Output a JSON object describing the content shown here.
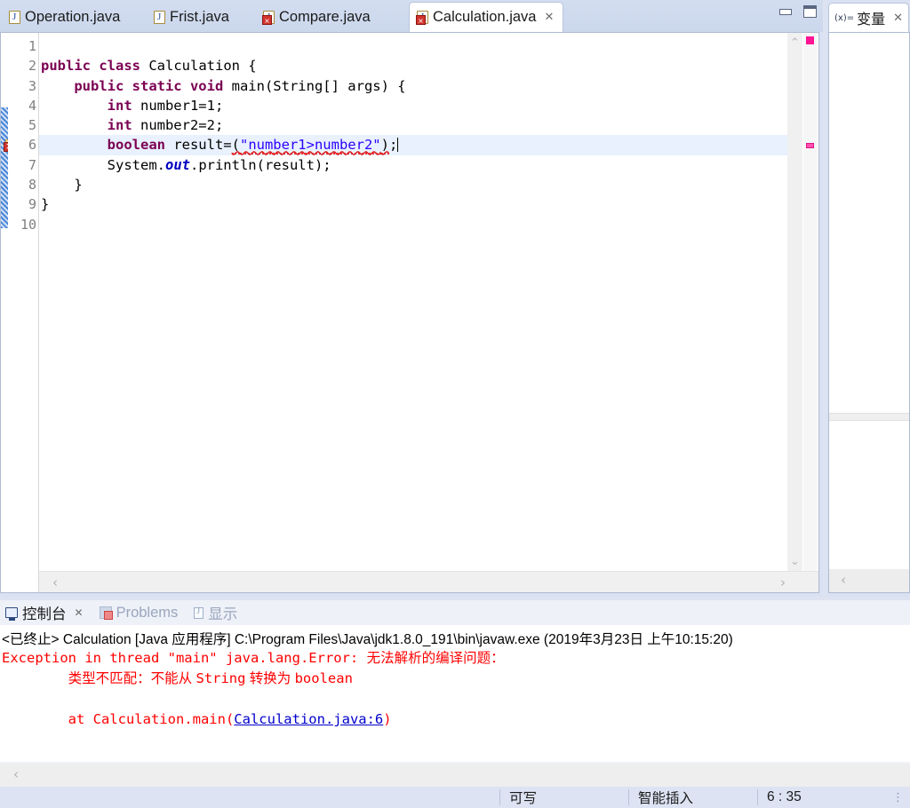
{
  "editor": {
    "tabs": [
      {
        "label": "Operation.java",
        "icon": "java-file-icon",
        "has_error": false,
        "active": false,
        "closable": false
      },
      {
        "label": "Frist.java",
        "icon": "java-file-icon",
        "has_error": false,
        "active": false,
        "closable": false
      },
      {
        "label": "Compare.java",
        "icon": "java-file-error-icon",
        "has_error": true,
        "active": false,
        "closable": false
      },
      {
        "label": "Calculation.java",
        "icon": "java-file-error-icon",
        "has_error": true,
        "active": true,
        "closable": true
      }
    ],
    "close_glyph": "✕",
    "window_buttons": {
      "minimize": "minimize-icon",
      "maximize": "maximize-icon"
    },
    "line_numbers": [
      "1",
      "2",
      "3",
      "4",
      "5",
      "6",
      "7",
      "8",
      "9",
      "10"
    ],
    "fold_marker_line": "3",
    "fold_glyph": "⊖",
    "code_lines": [
      {
        "n": 1,
        "segments": []
      },
      {
        "n": 2,
        "segments": [
          {
            "t": "public class ",
            "c": "kw"
          },
          {
            "t": "Calculation {",
            "c": "plain"
          }
        ]
      },
      {
        "n": 3,
        "segments": [
          {
            "t": "    ",
            "c": "plain"
          },
          {
            "t": "public static void ",
            "c": "kw"
          },
          {
            "t": "main(String[] args) {",
            "c": "plain"
          }
        ]
      },
      {
        "n": 4,
        "segments": [
          {
            "t": "        ",
            "c": "plain"
          },
          {
            "t": "int ",
            "c": "kw"
          },
          {
            "t": "number1=1;",
            "c": "plain"
          }
        ]
      },
      {
        "n": 5,
        "segments": [
          {
            "t": "        ",
            "c": "plain"
          },
          {
            "t": "int ",
            "c": "kw"
          },
          {
            "t": "number2=2;",
            "c": "plain"
          }
        ]
      },
      {
        "n": 6,
        "highlight": true,
        "segments": [
          {
            "t": "        ",
            "c": "plain"
          },
          {
            "t": "boolean ",
            "c": "kw"
          },
          {
            "t": "result=",
            "c": "plain"
          },
          {
            "t": "(",
            "c": "plain squig"
          },
          {
            "t": "\"number1>number2\"",
            "c": "str squig"
          },
          {
            "t": ")",
            "c": "plain squig"
          },
          {
            "t": ";",
            "c": "plain"
          }
        ]
      },
      {
        "n": 7,
        "segments": [
          {
            "t": "        System.",
            "c": "plain"
          },
          {
            "t": "out",
            "c": "stat"
          },
          {
            "t": ".println(result);",
            "c": "plain"
          }
        ]
      },
      {
        "n": 8,
        "segments": [
          {
            "t": "    }",
            "c": "plain"
          }
        ]
      },
      {
        "n": 9,
        "segments": [
          {
            "t": "}",
            "c": "plain"
          }
        ]
      },
      {
        "n": 10,
        "segments": []
      }
    ],
    "gutter_error_line": 6,
    "overview_markers": [
      "error-top-marker",
      "error-line6-marker"
    ],
    "scroll_arrows": {
      "up": "⌃",
      "down": "⌄",
      "left": "‹",
      "right": "›"
    }
  },
  "variables_view": {
    "tab_label": "变量",
    "tab_icon_text": "(x)=",
    "close_glyph": "✕",
    "scroll_left_glyph": "‹"
  },
  "console": {
    "tabs": [
      {
        "label": "控制台",
        "icon": "console-monitor-icon",
        "active": true,
        "closable": true
      },
      {
        "label": "Problems",
        "icon": "problems-icon",
        "active": false,
        "closable": false
      },
      {
        "label": "显示",
        "icon": "display-view-icon",
        "active": false,
        "closable": false
      }
    ],
    "close_glyph": "✕",
    "process_line": "<已终止> Calculation [Java 应用程序] C:\\Program Files\\Java\\jdk1.8.0_191\\bin\\javaw.exe  (2019年3月23日 上午10:15:20)",
    "output": [
      {
        "parts": [
          {
            "t": "Exception in thread \"main\" java.lang.Error: ",
            "c": "err-red"
          },
          {
            "t": "无法解析的编译问题：",
            "c": "err-red cjk"
          }
        ]
      },
      {
        "parts": [
          {
            "t": "\t",
            "c": "err-red"
          },
          {
            "t": "类型不匹配：不能从 ",
            "c": "err-red cjk"
          },
          {
            "t": "String",
            "c": "err-red"
          },
          {
            "t": " 转换为 ",
            "c": "err-red cjk"
          },
          {
            "t": "boolean",
            "c": "err-red"
          }
        ]
      },
      {
        "parts": []
      },
      {
        "parts": [
          {
            "t": "\tat Calculation.main(",
            "c": "err-red"
          },
          {
            "t": "Calculation.java:6",
            "c": "link"
          },
          {
            "t": ")",
            "c": "err-red"
          }
        ]
      }
    ],
    "scroll_left_glyph": "‹"
  },
  "status_bar": {
    "writable": "可写",
    "insert_mode": "智能插入",
    "cursor_position": "6 : 35",
    "grip_glyph": "⋮"
  }
}
